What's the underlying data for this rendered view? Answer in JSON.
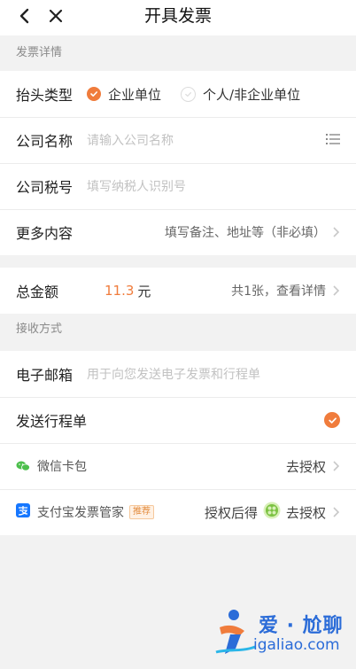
{
  "nav": {
    "title": "开具发票"
  },
  "sections": {
    "details": "发票详情",
    "receive": "接收方式"
  },
  "header_type": {
    "label": "抬头类型",
    "options": [
      "企业单位",
      "个人/非企业单位"
    ],
    "selected": "企业单位"
  },
  "company_name": {
    "label": "公司名称",
    "placeholder": "请输入公司名称"
  },
  "tax_no": {
    "label": "公司税号",
    "placeholder": "填写纳税人识别号"
  },
  "more": {
    "label": "更多内容",
    "hint": "填写备注、地址等（非必填）"
  },
  "total": {
    "label": "总金额",
    "amount": "11.3",
    "unit": "元",
    "detail": "共1张，查看详情"
  },
  "email": {
    "label": "电子邮箱",
    "placeholder": "用于向您发送电子发票和行程单"
  },
  "send_trip": {
    "label": "发送行程单",
    "checked": true
  },
  "wechat": {
    "label": "微信卡包",
    "action": "去授权"
  },
  "alipay": {
    "label": "支付宝发票管家",
    "badge": "推荐",
    "pre": "授权后得",
    "action": "去授权"
  },
  "watermark": {
    "line1": "爱 · 尬聊",
    "line2": "igaliao.com"
  },
  "colors": {
    "accent": "#f07c3c",
    "wechat": "#4cbf4c",
    "alipay": "#1677ff"
  }
}
